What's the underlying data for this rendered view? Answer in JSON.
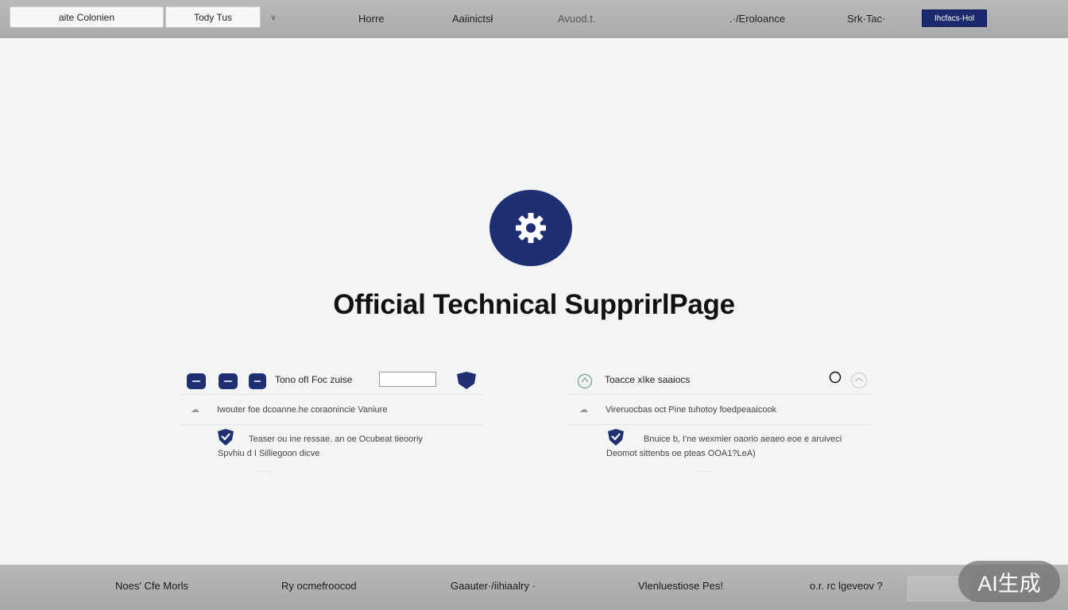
{
  "topbar": {
    "tab1": "aite Colonien",
    "tab2": "Tody Tus",
    "nav": [
      "Horre",
      "Aaiinictsł",
      "Avuod.t.",
      ".·/Eroloance",
      "Srk·Tac·"
    ],
    "cta": "Ihcfacs·Hol"
  },
  "hero": {
    "title": "Official Technical SupprirlPage"
  },
  "left_card": {
    "row1": "Tono ofI Foc zuise",
    "row2": "Iwouter foe dcoanne.he coraonincie Vaniure",
    "row3_line1": "Teaser   ou ine ressae. an oe Ocubeat tieooriy",
    "row3_line2": "Spvhiu d I Silliegoon dicve",
    "link": "·· ·· ·· ··"
  },
  "right_card": {
    "row1": "Toacce xIke saaiocs",
    "row2": "Vireruocbas oct Pine tuhotoy    foedpeaaicook",
    "row3_line1": "Bnuice b,    I'ne wexmier oaorio aeaeo eoe e aruiveci",
    "row3_line2": "Deomot sittenbs oe pteas OOA1?LeA)",
    "link": "·· ·· ·· ··"
  },
  "footer": {
    "items": [
      "Noes' Cfe Morls",
      "Ry ocmefroocod",
      "Gaauter·/iihiaalry  ·",
      "Vlenluestiose Pes!",
      "o.r. rc lgeveov ?"
    ]
  },
  "watermark": "AI生成",
  "colors": {
    "brand_navy": "#1f2f72",
    "bar_gray": "#aeafb1"
  }
}
